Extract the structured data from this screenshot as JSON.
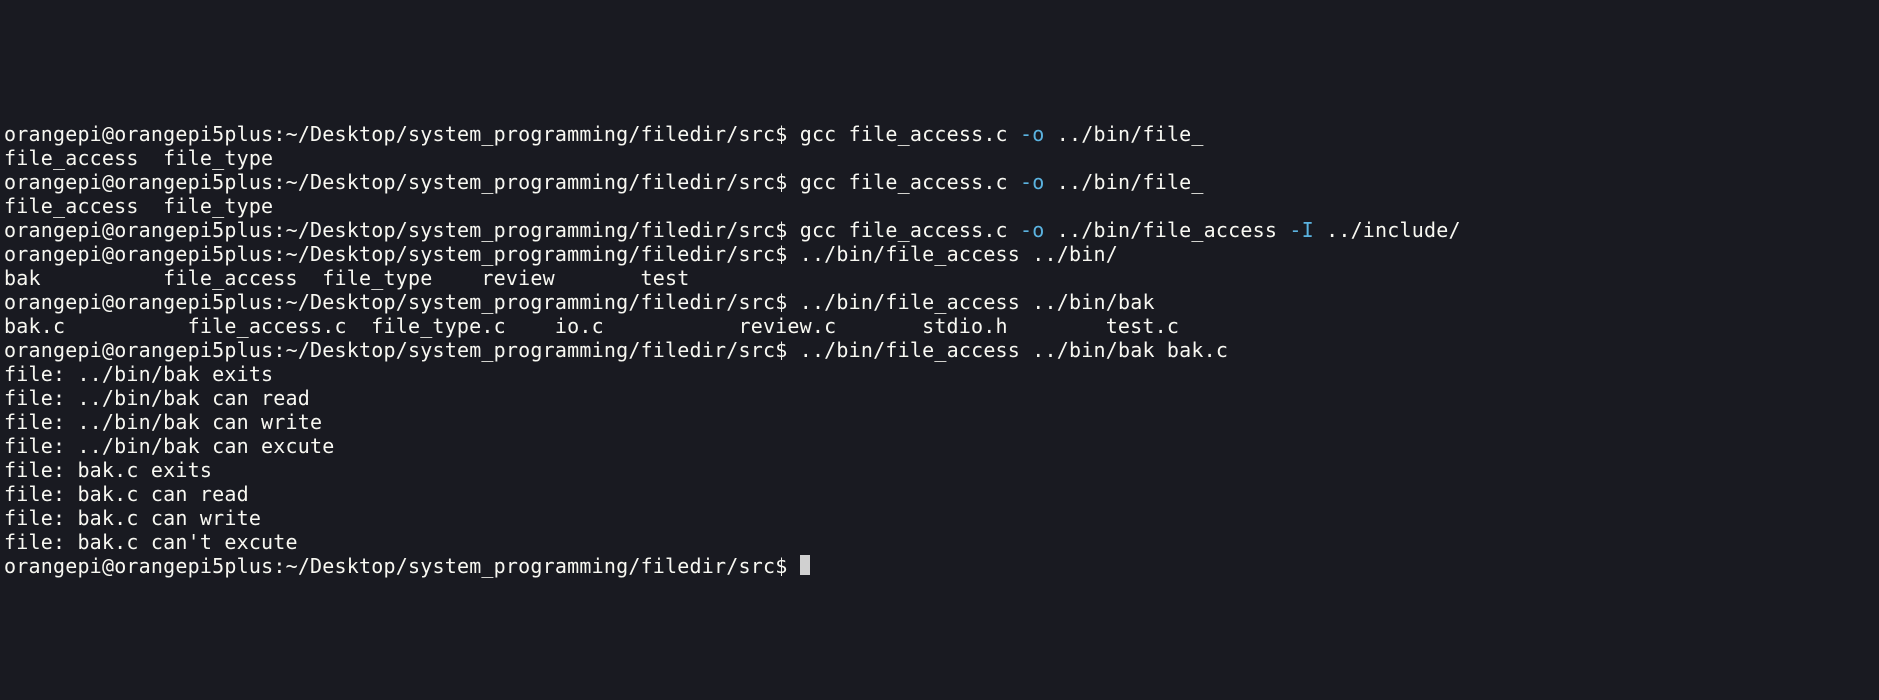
{
  "prompt": {
    "user": "orangepi",
    "host": "orangepi5plus",
    "path": "~/Desktop/system_programming/filedir/src",
    "symbol": "$"
  },
  "lines": [
    {
      "type": "cmd",
      "parts": [
        {
          "t": "plain",
          "v": "gcc file_access.c "
        },
        {
          "t": "flag",
          "v": "-o"
        },
        {
          "t": "plain",
          "v": " ../bin/file_"
        }
      ]
    },
    {
      "type": "out",
      "v": "file_access  file_type  "
    },
    {
      "type": "cmd",
      "parts": [
        {
          "t": "plain",
          "v": "gcc file_access.c "
        },
        {
          "t": "flag",
          "v": "-o"
        },
        {
          "t": "plain",
          "v": " ../bin/file_"
        }
      ]
    },
    {
      "type": "out",
      "v": "file_access  file_type  "
    },
    {
      "type": "cmd",
      "parts": [
        {
          "t": "plain",
          "v": "gcc file_access.c "
        },
        {
          "t": "flag",
          "v": "-o"
        },
        {
          "t": "plain",
          "v": " ../bin/file_access "
        },
        {
          "t": "flag",
          "v": "-I"
        },
        {
          "t": "plain",
          "v": " ../include/"
        }
      ]
    },
    {
      "type": "cmd",
      "parts": [
        {
          "t": "plain",
          "v": "../bin/file_access ../bin/"
        }
      ]
    },
    {
      "type": "out",
      "v": "bak          file_access  file_type    review       test         "
    },
    {
      "type": "cmd",
      "parts": [
        {
          "t": "plain",
          "v": "../bin/file_access ../bin/bak"
        }
      ]
    },
    {
      "type": "out",
      "v": "bak.c          file_access.c  file_type.c    io.c           review.c       stdio.h        test.c         "
    },
    {
      "type": "cmd",
      "parts": [
        {
          "t": "plain",
          "v": "../bin/file_access ../bin/bak bak.c"
        }
      ]
    },
    {
      "type": "out",
      "v": "file: ../bin/bak exits"
    },
    {
      "type": "out",
      "v": "file: ../bin/bak can read"
    },
    {
      "type": "out",
      "v": "file: ../bin/bak can write"
    },
    {
      "type": "out",
      "v": "file: ../bin/bak can excute"
    },
    {
      "type": "out",
      "v": "file: bak.c exits"
    },
    {
      "type": "out",
      "v": "file: bak.c can read"
    },
    {
      "type": "out",
      "v": "file: bak.c can write"
    },
    {
      "type": "out",
      "v": "file: bak.c can't excute"
    },
    {
      "type": "cmd",
      "parts": [],
      "cursor": true
    }
  ]
}
